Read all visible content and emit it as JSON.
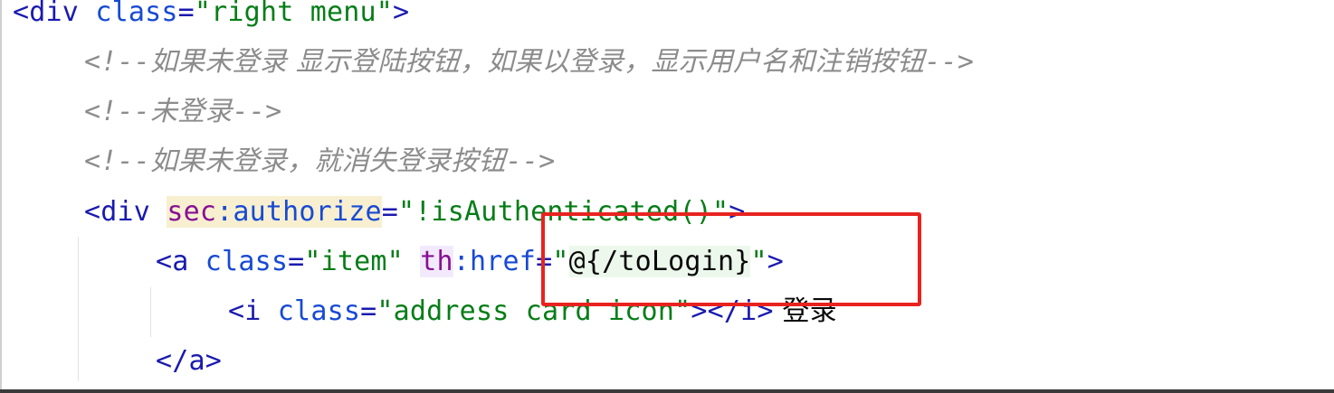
{
  "editor": {
    "lines": [
      {
        "tokens": {
          "t1": "<div ",
          "t2": "class",
          "t3": "=",
          "t4": "\"right menu\"",
          "t5": ">"
        }
      },
      {
        "comment_open": "<!--",
        "comment_text": "如果未登录 显示登陆按钮，如果以登录，显示用户名和注销按钮",
        "comment_close": "-->"
      },
      {
        "comment_open": "<!--",
        "comment_text": "未登录",
        "comment_close": "-->"
      },
      {
        "comment_open": "<!--",
        "comment_text": "如果未登录，就消失登录按钮",
        "comment_close": "-->"
      },
      {
        "tokens": {
          "t1": "<div ",
          "t2_ns": "sec",
          "t2_colon": ":",
          "t2_name": "authorize",
          "t3": "=",
          "t4": "\"!isAuthenticated()\"",
          "t5": ">"
        }
      },
      {
        "tokens": {
          "t1": "<a ",
          "t2": "class",
          "t3": "=",
          "t4": "\"item\"",
          "t5_ns": "th",
          "t5_colon": ":",
          "t5_name": "href",
          "t6": "=",
          "t7_q1": "\"",
          "t7_expr": "@{/toLogin}",
          "t7_q2": "\"",
          "t8": ">"
        }
      },
      {
        "tokens": {
          "t1": "<i ",
          "t2": "class",
          "t3": "=",
          "t4": "\"address card icon\"",
          "t5": "></i>",
          "t6": " 登录"
        }
      },
      {
        "tokens": {
          "t1": "</a>"
        }
      }
    ],
    "colors": {
      "tag": "#1a1ab0",
      "attribute": "#174ad4",
      "string": "#067d17",
      "namespace": "#871094",
      "comment": "#8c8c8c",
      "highlight_box": "#e8231f"
    }
  }
}
